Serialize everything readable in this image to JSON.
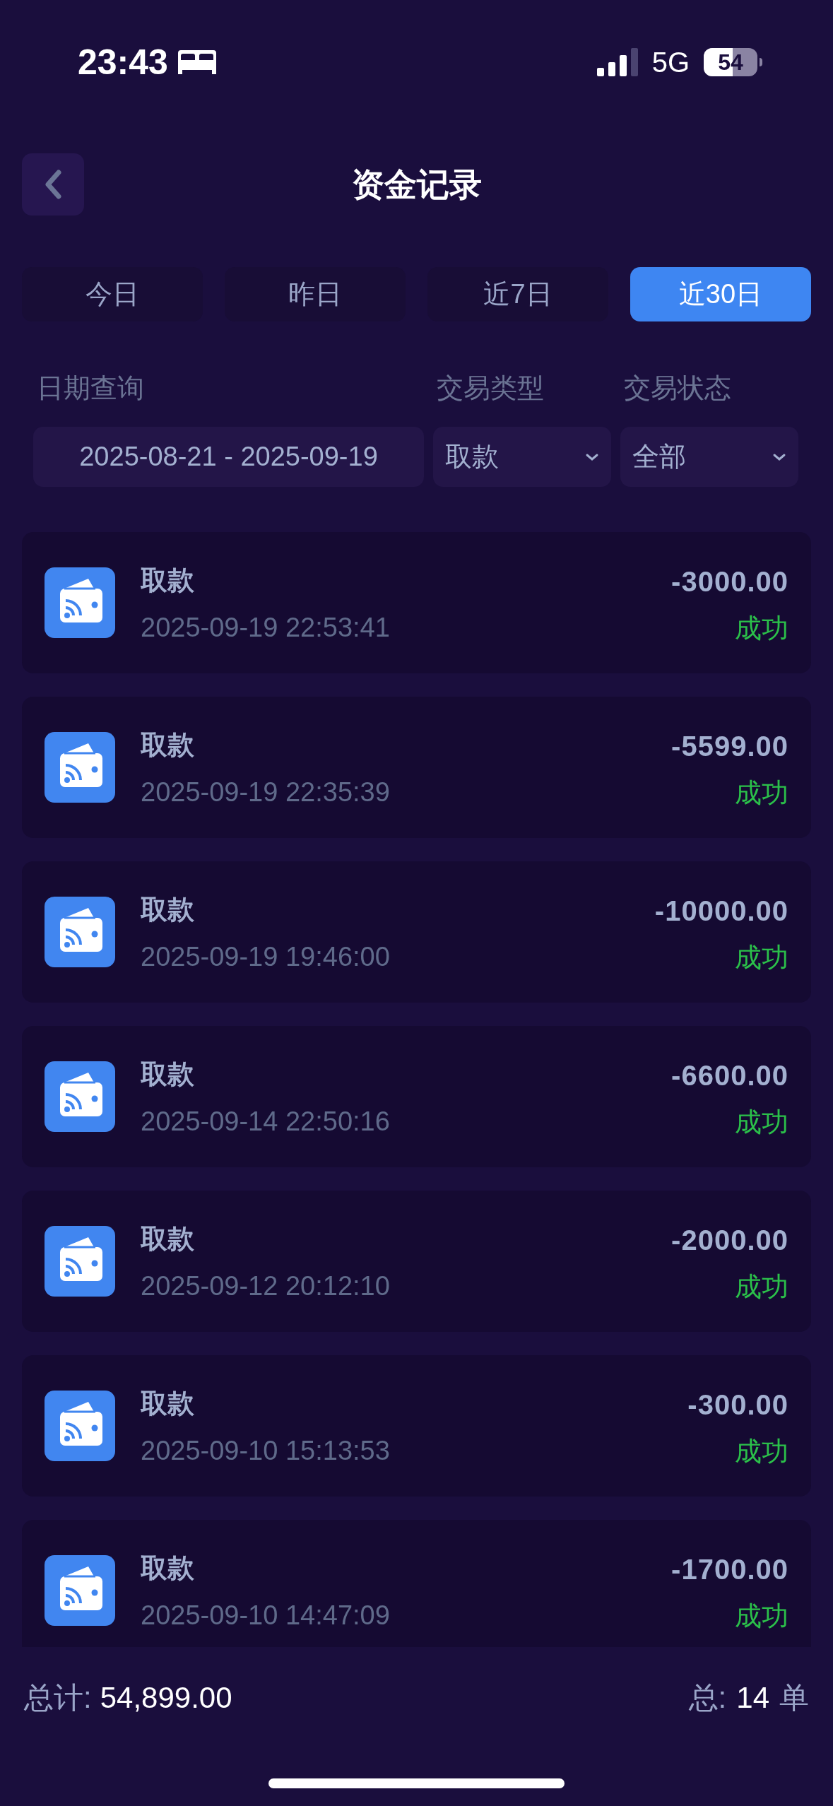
{
  "status_bar": {
    "time": "23:43",
    "network": "5G",
    "battery": "54"
  },
  "header": {
    "title": "资金记录"
  },
  "tabs": [
    {
      "label": "今日",
      "selected": false
    },
    {
      "label": "昨日",
      "selected": false
    },
    {
      "label": "近7日",
      "selected": false
    },
    {
      "label": "近30日",
      "selected": true
    }
  ],
  "filters": [
    {
      "label": "日期查询",
      "value": "2025-08-21 - 2025-09-19",
      "kind": "date"
    },
    {
      "label": "交易类型",
      "value": "取款",
      "kind": "select"
    },
    {
      "label": "交易状态",
      "value": "全部",
      "kind": "select"
    }
  ],
  "records": [
    {
      "title": "取款",
      "time": "2025-09-19 22:53:41",
      "amount": "-3000.00",
      "status": "成功"
    },
    {
      "title": "取款",
      "time": "2025-09-19 22:35:39",
      "amount": "-5599.00",
      "status": "成功"
    },
    {
      "title": "取款",
      "time": "2025-09-19 19:46:00",
      "amount": "-10000.00",
      "status": "成功"
    },
    {
      "title": "取款",
      "time": "2025-09-14 22:50:16",
      "amount": "-6600.00",
      "status": "成功"
    },
    {
      "title": "取款",
      "time": "2025-09-12 20:12:10",
      "amount": "-2000.00",
      "status": "成功"
    },
    {
      "title": "取款",
      "time": "2025-09-10 15:13:53",
      "amount": "-300.00",
      "status": "成功"
    },
    {
      "title": "取款",
      "time": "2025-09-10 14:47:09",
      "amount": "-1700.00",
      "status": "成功"
    }
  ],
  "footer": {
    "total_label": "总计:",
    "total": "54,899.00",
    "count_label": "总:",
    "count": "14",
    "count_unit": "单"
  }
}
